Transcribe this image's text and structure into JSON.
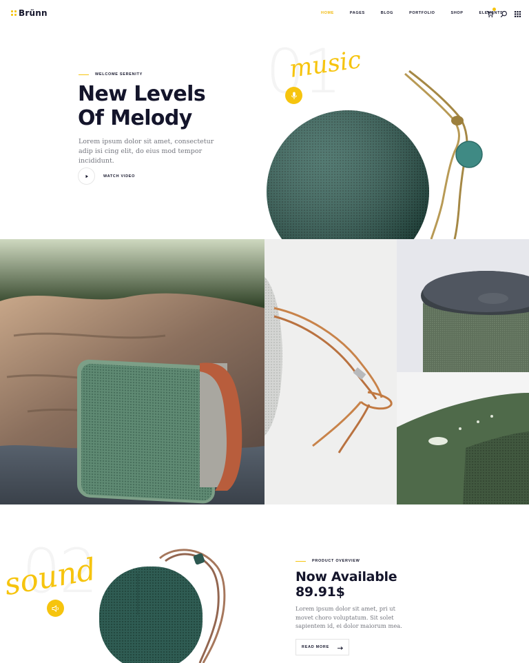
{
  "brand": {
    "name": "Brünn",
    "accent": "#f6c40e",
    "dark": "#14152b"
  },
  "nav": {
    "items": [
      {
        "label": "HOME",
        "active": true
      },
      {
        "label": "PAGES",
        "active": false
      },
      {
        "label": "BLOG",
        "active": false
      },
      {
        "label": "PORTFOLIO",
        "active": false
      },
      {
        "label": "SHOP",
        "active": false
      },
      {
        "label": "ELEMENTS",
        "active": false
      }
    ],
    "icons": [
      "cart-icon",
      "search-icon",
      "grid-menu-icon"
    ]
  },
  "hero": {
    "eyebrow": "WELCOME SERENITY",
    "title_line1": "New Levels",
    "title_line2": "Of Melody",
    "description": "Lorem ipsum dolor sit amet, consectetur adip isi cing elit, do eius mod tempor incididunt.",
    "watch_label": "WATCH VIDEO",
    "number": "01",
    "script_word": "music",
    "badge_icon": "microphone-icon"
  },
  "product": {
    "number": "02",
    "script_word": "sound",
    "badge_icon": "speaker-icon",
    "eyebrow": "PRODUCT OVERVIEW",
    "title_line1": "Now Available",
    "title_line2": "89.91$",
    "description": "Lorem ipsum dolor sit amet, pri ut movet choro voluptatum. Sit solet sapientem id, ei dolor maiorum mea.",
    "button_label": "READ MORE"
  }
}
